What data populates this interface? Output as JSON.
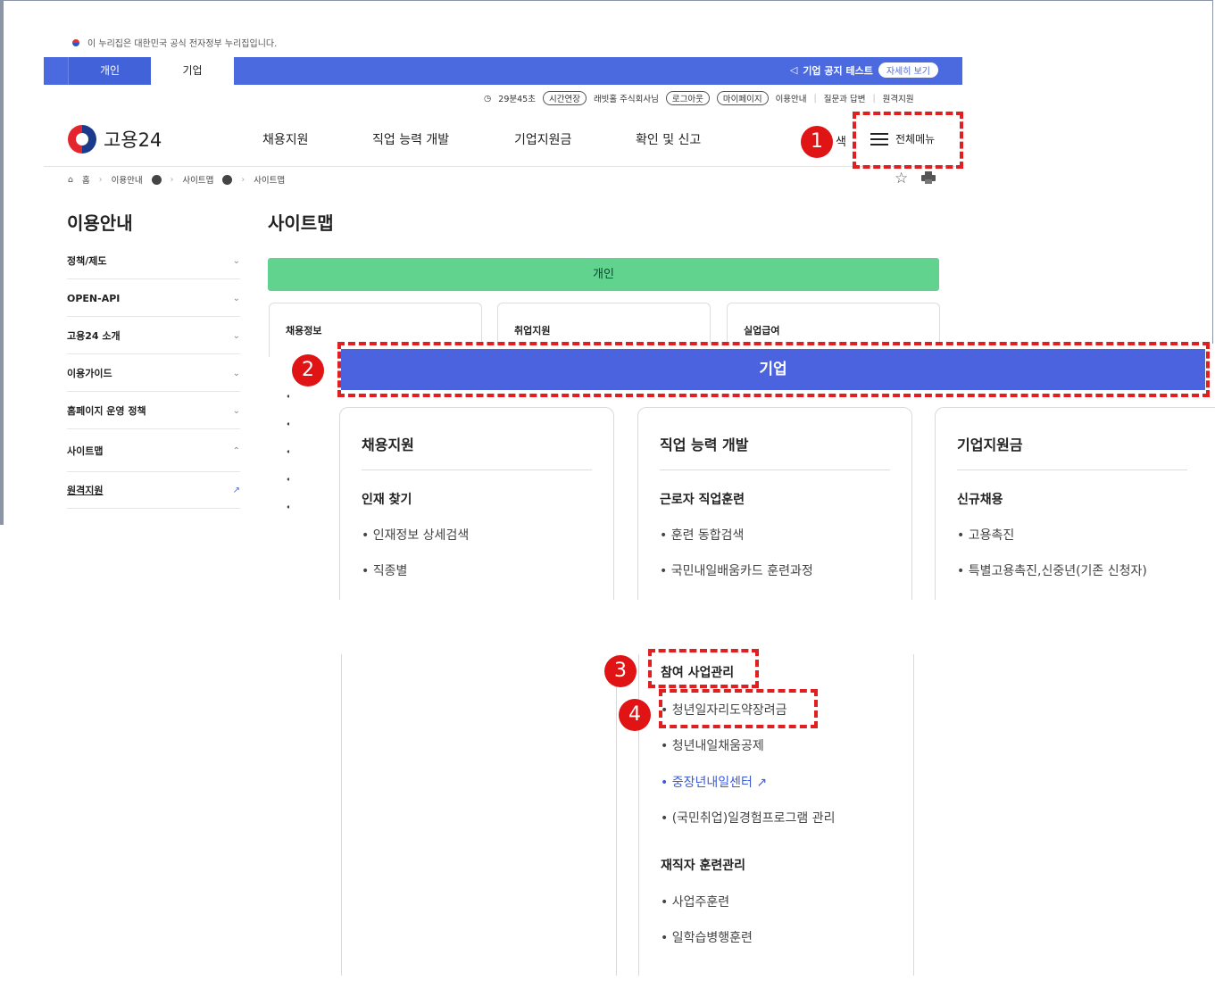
{
  "gov_banner": {
    "text": "이 누리집은 대한민국 공식 전자정부 누리집입니다."
  },
  "top_tabs": [
    {
      "label": "개인"
    },
    {
      "label": "기업"
    }
  ],
  "notice": {
    "label": "기업 공지 테스트",
    "button": "자세히 보기"
  },
  "util": {
    "timer": "29분45초",
    "extend": "시간연장",
    "user": "래빗홀 주식회사님",
    "logout": "로그아웃",
    "mypage": "마이페이지",
    "links": [
      "이용안내",
      "질문과 답변",
      "원격지원"
    ]
  },
  "header": {
    "logo": "고용24",
    "gnb": [
      "채용지원",
      "직업 능력 개발",
      "기업지원금",
      "확인 및 신고"
    ],
    "search_fragment": "색",
    "all_menu": "전체메뉴"
  },
  "breadcrumb": [
    "홈",
    "이용안내",
    "사이트맵",
    "사이트맵"
  ],
  "sidebar": {
    "title": "이용안내",
    "items": [
      "정책/제도",
      "OPEN-API",
      "고용24 소개",
      "이용가이드",
      "홈페이지 운영 정책",
      "사이트맵",
      "원격지원"
    ]
  },
  "sitemap": {
    "title": "사이트맵",
    "personal_bar": "개인",
    "personal_cards": [
      "채용정보",
      "취업지원",
      "실업급여"
    ],
    "company_bar": "기업",
    "columns": [
      {
        "title": "채용지원",
        "sub": "인재 찾기",
        "items": [
          "• 인재정보 상세검색",
          "• 직종별"
        ]
      },
      {
        "title": "직업 능력 개발",
        "sub": "근로자 직업훈련",
        "items": [
          "• 훈련 동합검색",
          "• 국민내일배움카드 훈련과정"
        ]
      },
      {
        "title": "기업지원금",
        "sub": "신규채용",
        "items": [
          "• 고용촉진",
          "• 특별고용촉진,신중년(기존 신청자)"
        ]
      }
    ],
    "lower": {
      "group1": "참여 사업관리",
      "group1_items": [
        "• 청년일자리도약장려금",
        "• 청년내일채움공제",
        "• 중장년내일센터",
        "• (국민취업)일경험프로그램 관리"
      ],
      "group2": "재직자 훈련관리",
      "group2_items": [
        "• 사업주훈련",
        "• 일학습병행훈련"
      ]
    }
  },
  "badges": [
    "1",
    "2",
    "3",
    "4"
  ],
  "colors": {
    "primary": "#4c63e0",
    "green": "#61d38f",
    "annotation": "#e02020"
  }
}
